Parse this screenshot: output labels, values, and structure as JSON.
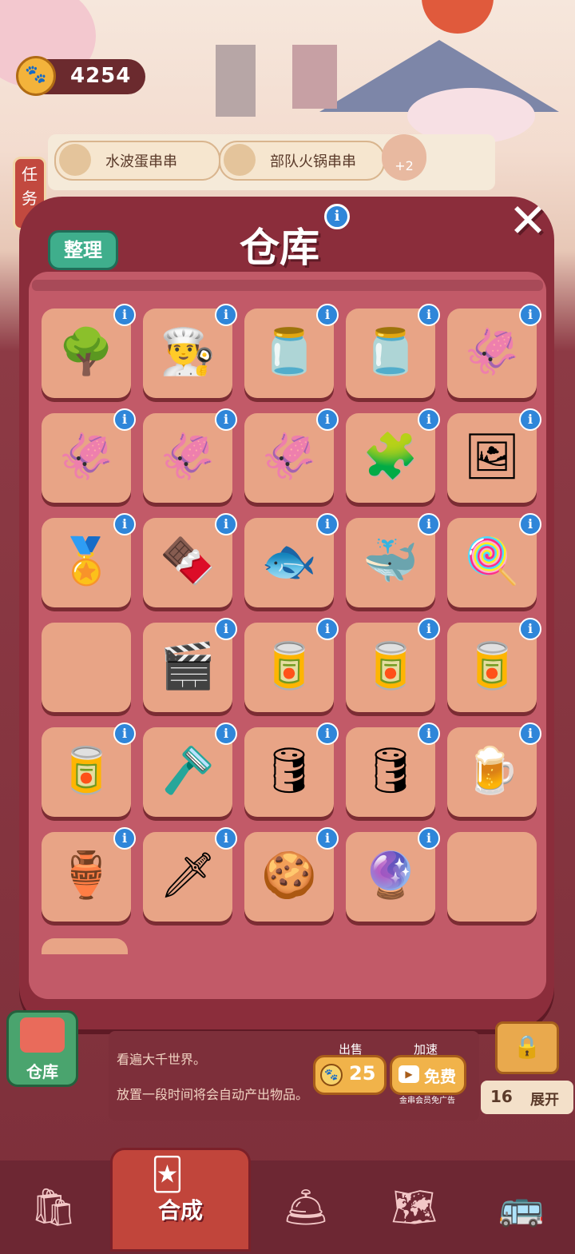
{
  "currency": {
    "amount": "4254"
  },
  "orders": [
    {
      "name": "水波蛋串串"
    },
    {
      "name": "部队火锅串串"
    }
  ],
  "task_button": {
    "label": "任务"
  },
  "bonus_badge": {
    "label": "+2"
  },
  "dialog": {
    "title": "仓库",
    "sort_button": "整理",
    "close_symbol": "✕",
    "info_symbol": "i",
    "rows": [
      [
        {
          "icon": "tree-icon",
          "glyph": "🌳"
        },
        {
          "icon": "chef-hat-icon",
          "glyph": "👨‍🍳"
        },
        {
          "icon": "caviar-jar-icon",
          "glyph": "🫙"
        },
        {
          "icon": "caviar-jar-icon",
          "glyph": "🫙"
        },
        {
          "icon": "squid-shreds-icon",
          "glyph": "🦑"
        }
      ],
      [
        {
          "icon": "squid-shreds-icon",
          "glyph": "🦑"
        },
        {
          "icon": "squid-shreds-icon",
          "glyph": "🦑"
        },
        {
          "icon": "squid-shreds-icon",
          "glyph": "🦑"
        },
        {
          "icon": "puzzle-pieces-icon",
          "glyph": "🧩"
        },
        {
          "icon": "puzzle-picture-icon",
          "glyph": "🖼"
        }
      ],
      [
        {
          "icon": "award-medal-icon",
          "glyph": "🏅"
        },
        {
          "icon": "chocolate-box-icon",
          "glyph": "🍫"
        },
        {
          "icon": "fish-icon",
          "glyph": "🐟"
        },
        {
          "icon": "whale-icon",
          "glyph": "🐳"
        },
        {
          "icon": "lollipop-icon",
          "glyph": "🍭"
        }
      ],
      [
        {
          "icon": "",
          "glyph": ""
        },
        {
          "icon": "clapperboard-icon",
          "glyph": "🎬"
        },
        {
          "icon": "jar-icon",
          "glyph": "🥫"
        },
        {
          "icon": "jar-icon",
          "glyph": "🥫"
        },
        {
          "icon": "jar-icon",
          "glyph": "🥫"
        }
      ],
      [
        {
          "icon": "jar-icon",
          "glyph": "🥫"
        },
        {
          "icon": "razor-icon",
          "glyph": "🪒"
        },
        {
          "icon": "barrel-icon",
          "glyph": "🛢"
        },
        {
          "icon": "barrel-icon",
          "glyph": "🛢"
        },
        {
          "icon": "keg-icon",
          "glyph": "🍺"
        }
      ],
      [
        {
          "icon": "golden-lamp-icon",
          "glyph": "🏺"
        },
        {
          "icon": "kunai-icon",
          "glyph": "🗡"
        },
        {
          "icon": "cookie-icon",
          "glyph": "🍪"
        },
        {
          "icon": "crystal-ball-icon",
          "glyph": "🔮"
        },
        {
          "icon": "",
          "glyph": ""
        }
      ]
    ]
  },
  "producer": {
    "line1": "看遍大千世界。",
    "line2": "放置一段时间将会自动产出物品。",
    "sell_label": "出售",
    "sell_price": "25",
    "speed_label": "加速",
    "speed_value": "免费",
    "speed_note": "金串会员免广告"
  },
  "storage_button": {
    "label": "仓库"
  },
  "expand": {
    "count": "16",
    "label": "展开"
  },
  "nav": {
    "active_label": "合成"
  },
  "colors": {
    "dialog": "#8b2d3b",
    "cell": "#e8a486",
    "info": "#2f86d9",
    "sort": "#3fae8c"
  }
}
